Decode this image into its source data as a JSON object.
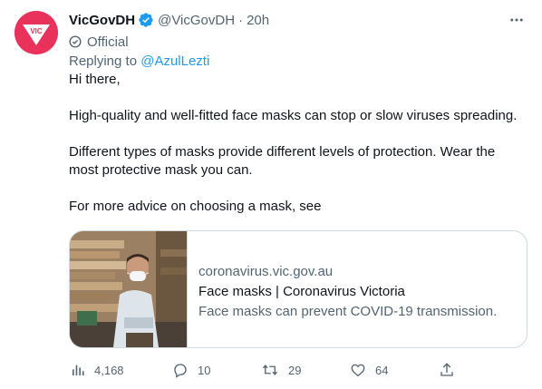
{
  "tweet": {
    "display_name": "VicGovDH",
    "handle": "@VicGovDH",
    "separator": "·",
    "time": "20h",
    "badge": "Official",
    "replying_prefix": "Replying to",
    "replying_to": "@AzulLezti",
    "paragraphs": [
      "Hi there,",
      "High-quality and well-fitted face masks can stop or slow viruses spreading.",
      "Different types of masks provide different levels of protection. Wear the most protective mask you can.",
      "For more advice on choosing a mask, see"
    ]
  },
  "avatar": {
    "text": "VIC",
    "color": "#e8315b"
  },
  "card": {
    "domain": "coronavirus.vic.gov.au",
    "title": "Face masks | Coronavirus Victoria",
    "description": "Face masks can prevent COVID-19 transmission."
  },
  "actions": {
    "views": "4,168",
    "replies": "10",
    "retweets": "29",
    "likes": "64"
  },
  "icons": [
    "verified-icon",
    "more-icon",
    "official-icon",
    "views-icon",
    "reply-icon",
    "retweet-icon",
    "like-icon",
    "share-icon"
  ],
  "colors": {
    "accent": "#1d9bf0",
    "muted": "#536471",
    "text": "#0f1419",
    "border": "#cfd9de"
  }
}
